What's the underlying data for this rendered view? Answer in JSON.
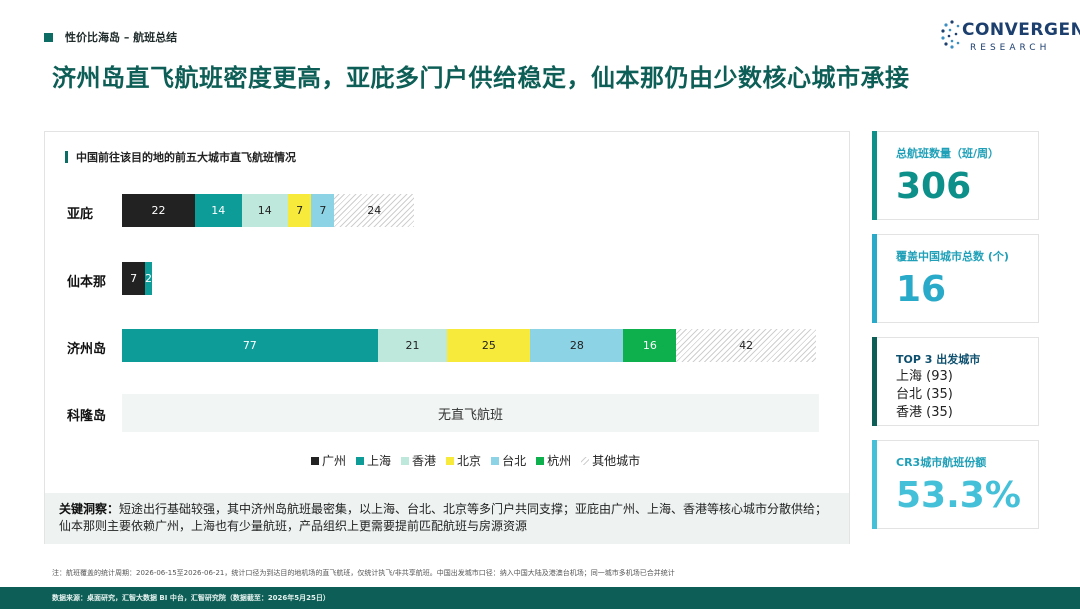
{
  "header": {
    "section": "性价比海岛 – 航班总结",
    "title": "济州岛直飞航班密度更高，亚庇多门户供给稳定，仙本那仍由少数核心城市承接"
  },
  "logo": {
    "brand": "CONVERGENT",
    "sub": "RESEARCH"
  },
  "chart_data": {
    "type": "bar",
    "orientation": "horizontal-stacked",
    "title": "中国前往该目的地的前五大城市直飞航班情况",
    "categories": [
      "亚庇",
      "仙本那",
      "济州岛",
      "科隆岛"
    ],
    "series": [
      {
        "name": "广州",
        "color": "#222222",
        "values": [
          22,
          7,
          null,
          null
        ]
      },
      {
        "name": "上海",
        "color": "#0e9c98",
        "values": [
          14,
          2,
          77,
          null
        ]
      },
      {
        "name": "香港",
        "color": "#bfe8dc",
        "values": [
          14,
          null,
          21,
          null
        ]
      },
      {
        "name": "北京",
        "color": "#f7ea3b",
        "values": [
          7,
          null,
          25,
          null
        ]
      },
      {
        "name": "台北",
        "color": "#8dd3e6",
        "values": [
          7,
          null,
          28,
          null
        ]
      },
      {
        "name": "杭州",
        "color": "#0db04c",
        "values": [
          null,
          null,
          16,
          null
        ]
      },
      {
        "name": "其他城市",
        "color": "hatched",
        "values": [
          24,
          null,
          42,
          null
        ]
      }
    ],
    "no_data_label": "无直飞航班",
    "legend_position": "bottom"
  },
  "insight": {
    "label": "关键洞察：",
    "text": "短途出行基础较强，其中济州岛航班最密集，以上海、台北、北京等多门户共同支撑；亚庇由广州、上海、香港等核心城市分散供给；仙本那则主要依赖广州，上海也有少量航班，产品组织上更需要提前匹配航班与房源资源"
  },
  "kpis": [
    {
      "label": "总航班数量（班/周）",
      "value": "306",
      "color": "#0d8f8a"
    },
    {
      "label": "覆盖中国城市总数 (个)",
      "value": "16",
      "color": "#2aaac9"
    },
    {
      "label": "TOP 3 出发城市",
      "items": [
        "上海 (93)",
        "台北 (35)",
        "香港 (35)"
      ],
      "color": "#0d5e56"
    },
    {
      "label": "CR3城市航班份额",
      "value": "53.3%",
      "color": "#44c0d8"
    }
  ],
  "footnote": "注：航班覆盖的统计周期：2026-06-15至2026-06-21，统计口径为到达目的地机场的直飞航班，仅统计执飞/非共享航班。中国出发城市口径：纳入中国大陆及港澳台机场；同一城市多机场已合并统计",
  "footer": "数据来源：桌面研究，汇智大数据 BI 中台，汇智研究院（数据截至：2026年5月25日）"
}
